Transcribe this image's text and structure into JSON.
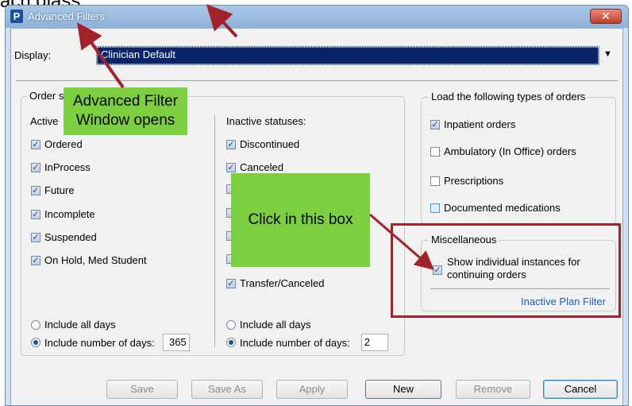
{
  "top_clip_text": "ach glass",
  "window": {
    "title": "Advanced Filters",
    "app_icon": "P",
    "close_glyph": "✕"
  },
  "display": {
    "label": "Display:",
    "selected": "Clinician Default"
  },
  "order_status": {
    "group_label": "Order s",
    "active_heading": "Active",
    "active_items": [
      {
        "label": "Ordered",
        "checked": true
      },
      {
        "label": "InProcess",
        "checked": true
      },
      {
        "label": "Future",
        "checked": true
      },
      {
        "label": "Incomplete",
        "checked": true
      },
      {
        "label": "Suspended",
        "checked": true
      },
      {
        "label": "On Hold, Med Student",
        "checked": true
      }
    ],
    "active_days": {
      "include_all": "Include all days",
      "include_number": "Include number of days:",
      "value": "365",
      "selected": "number"
    },
    "inactive_heading": "Inactive statuses:",
    "inactive_items": [
      {
        "label": "Discontinued",
        "checked": true
      },
      {
        "label": "Canceled",
        "checked": true
      },
      {
        "label": "Transfer/Canceled",
        "checked": true
      }
    ],
    "inactive_days": {
      "include_all": "Include all days",
      "include_number": "Include number of days:",
      "value": "2",
      "selected": "number"
    }
  },
  "load_types": {
    "group_label": "Load the following types of orders",
    "items": [
      {
        "label": "Inpatient orders",
        "checked": true
      },
      {
        "label": "Ambulatory (In Office) orders",
        "checked": false
      },
      {
        "label": "Prescriptions",
        "checked": false
      },
      {
        "label": "Documented medications",
        "checked": false
      }
    ]
  },
  "misc": {
    "group_label": "Miscellaneous",
    "show_instances_line1": "Show individual instances for",
    "show_instances_line2": "continuing orders",
    "show_instances_checked": true,
    "inactive_plan_link": "Inactive Plan Filter"
  },
  "buttons": {
    "save": "Save",
    "save_as": "Save As",
    "apply": "Apply",
    "new": "New",
    "remove": "Remove",
    "cancel": "Cancel"
  },
  "callouts": {
    "advanced_line1": "Advanced Filter",
    "advanced_line2": "Window opens",
    "click_box": "Click in this box"
  },
  "colors": {
    "callout_green": "#7ccf3e",
    "annotation_red": "#a3222a",
    "selection_blue": "#0a246a"
  }
}
